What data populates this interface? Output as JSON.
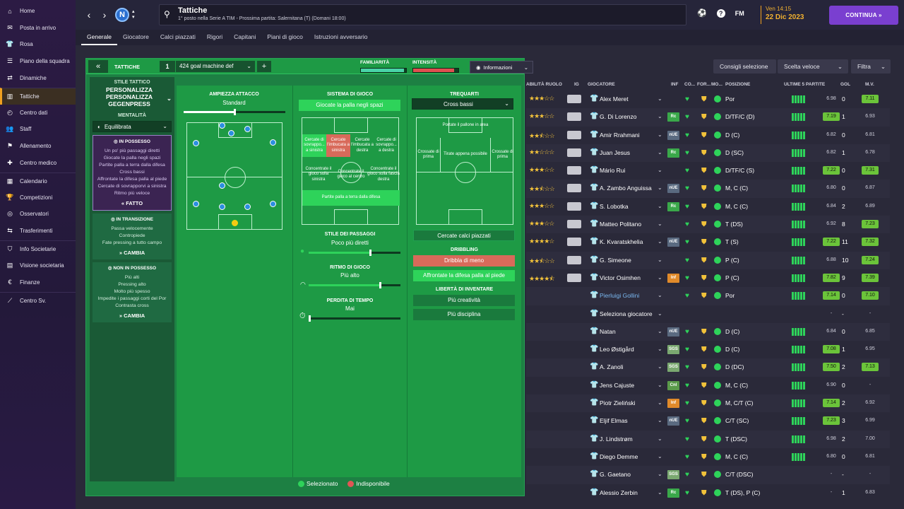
{
  "nav": [
    {
      "icon": "⌂",
      "label": "Home",
      "name": "home"
    },
    {
      "icon": "✉",
      "label": "Posta in arrivo",
      "name": "inbox"
    },
    {
      "icon": "👕",
      "label": "Rosa",
      "name": "squad"
    },
    {
      "icon": "☰",
      "label": "Piano della squadra",
      "name": "squad-plan"
    },
    {
      "icon": "⇄",
      "label": "Dinamiche",
      "name": "dynamics"
    },
    {
      "icon": "▥",
      "label": "Tattiche",
      "name": "tactics"
    },
    {
      "icon": "◴",
      "label": "Centro dati",
      "name": "data-hub"
    },
    {
      "icon": "👥",
      "label": "Staff",
      "name": "staff"
    },
    {
      "icon": "⚑",
      "label": "Allenamento",
      "name": "training"
    },
    {
      "icon": "✚",
      "label": "Centro medico",
      "name": "medical"
    },
    {
      "icon": "▦",
      "label": "Calendario",
      "name": "calendar"
    },
    {
      "icon": "🏆",
      "label": "Competizioni",
      "name": "competitions"
    },
    {
      "icon": "◎",
      "label": "Osservatori",
      "name": "scouting"
    },
    {
      "icon": "⇆",
      "label": "Trasferimenti",
      "name": "transfers"
    },
    {
      "icon": "⛉",
      "label": "Info Societarie",
      "name": "club-info"
    },
    {
      "icon": "▤",
      "label": "Visione societaria",
      "name": "club-vision"
    },
    {
      "icon": "€",
      "label": "Finanze",
      "name": "finances"
    },
    {
      "icon": "⟋",
      "label": "Centro Sv.",
      "name": "dev-centre"
    }
  ],
  "header": {
    "title": "Tattiche",
    "subtitle": "1° posto nella Serie A TIM - Prossima partita: Salernitana (T) (Domani 18:00)",
    "club_initial": "N",
    "time": "Ven 14:15",
    "date": "22 Dic 2023",
    "fm": "FM",
    "continue": "CONTINUA »"
  },
  "tabs": [
    "Generale",
    "Giocatore",
    "Calci piazzati",
    "Rigori",
    "Capitani",
    "Piani di gioco",
    "Istruzioni avversario"
  ],
  "tactic": {
    "label": "TATTICHE",
    "num": "1",
    "name": "424 goal machine def",
    "fam_label": "FAMILIARITÀ",
    "int_label": "INTENSITÀ",
    "familiarity": 0.95,
    "intensity": 0.9
  },
  "left": {
    "style_title": "STILE TATTICO",
    "style_name": "PERSONALIZZA PERSONALIZZA GEGENPRESS",
    "mentality_title": "MENTALITÀ",
    "mentality": "Equilibrata",
    "possession": {
      "title": "IN POSSESSO",
      "items": [
        "Un po' più passaggi diretti",
        "Giocate la palla negli spazi",
        "Partite palla a terra dalla difesa",
        "Cross bassi",
        "Affrontate la difesa palla al piede",
        "Cercate di sovrapporvi a sinistra",
        "Ritmo più veloce"
      ],
      "action": "FATTO"
    },
    "transition": {
      "title": "IN TRANSIZIONE",
      "items": [
        "Passa velocemente",
        "Contropiede",
        "Fate pressing a tutto campo"
      ],
      "action": "CAMBIA"
    },
    "out": {
      "title": "NON IN POSSESSO",
      "items": [
        "Più alti",
        "Pressing alto",
        "Molto più spesso",
        "Impedite i passaggi corti del Por",
        "Contrasta cross"
      ],
      "action": "CAMBIA"
    }
  },
  "board": {
    "width_title": "AMPIEZZA ATTACCO",
    "width_val": "Standard",
    "system_title": "SISTEMA DI GIOCO",
    "system_btn": "Giocate la palla negli spazi",
    "zones": [
      "Cercate di sovrappo... a sinistra",
      "Cercate l'imbucata a sinistra",
      "Cercate l'imbucata a destra",
      "Cercate di sovrappo... a destra",
      "Concentrate il gioco sulla sinistra",
      "Concentrate il gioco al centro",
      "Concentrate il gioco sulla fascia destra",
      "Partite palla a terra dalla difesa"
    ],
    "pass_title": "STILE DEI PASSAGGI",
    "pass_val": "Poco più diretti",
    "tempo_title": "RITMO DI GIOCO",
    "tempo_val": "Più alto",
    "waste_title": "PERDITA DI TEMPO",
    "waste_val": "Mai",
    "final_title": "TREQUARTI",
    "final_sel": "Cross bassi",
    "final_zones": [
      "Portate il pallone in area",
      "Crossate di prima",
      "Tirate appena possibile",
      "Crossate di prima"
    ],
    "setpiece_btn": "Cercate calci piazzati",
    "dribble_title": "DRIBBLING",
    "dribble_a": "Dribbla di meno",
    "dribble_b": "Affrontate la difesa palla al piede",
    "creative_title": "LIBERTÀ DI INVENTARE",
    "creative_a": "Più creatività",
    "creative_b": "Più disciplina",
    "legend_sel": "Selezionato",
    "legend_unav": "Indisponibile"
  },
  "toolbar": {
    "info": "Informazioni",
    "advice": "Consigli selezione",
    "quick": "Scelta veloce",
    "filter": "Filtra"
  },
  "table": {
    "headers": [
      "ABILITÀ RUOLO",
      "IG",
      "GIOCATORE",
      "INF",
      "CO...",
      "FOR...",
      "MO...",
      "POSIZIONE",
      "ULTIME 5 PARTITE",
      "GOL",
      "M.V."
    ],
    "rows": [
      {
        "stars": "★★★☆☆",
        "name": "Alex Meret",
        "inf": "",
        "pos": "Por",
        "form": "6.98",
        "gol": "0",
        "mv": "7.11",
        "hl": true
      },
      {
        "stars": "★★★☆☆",
        "name": "G. Di Lorenzo",
        "inf": "Rc",
        "pos": "D/TF/C (D)",
        "form": "7.19",
        "gol": "1",
        "mv": "6.93",
        "hl": false
      },
      {
        "stars": "★★⯪☆☆",
        "name": "Amir Rrahmani",
        "inf": "nUE",
        "pos": "D (C)",
        "form": "6.82",
        "gol": "0",
        "mv": "6.81",
        "hl": false
      },
      {
        "stars": "★★☆☆☆",
        "name": "Juan Jesus",
        "inf": "Rc",
        "pos": "D (SC)",
        "form": "6.82",
        "gol": "1",
        "mv": "6.78",
        "hl": false
      },
      {
        "stars": "★★★☆☆",
        "name": "Mário Rui",
        "inf": "",
        "pos": "D/TF/C (S)",
        "form": "7.22",
        "gol": "0",
        "mv": "7.31",
        "hl": false
      },
      {
        "stars": "★★⯪☆☆",
        "name": "A. Zambo Anguissa",
        "inf": "nUE",
        "pos": "M, C (C)",
        "form": "6.80",
        "gol": "0",
        "mv": "6.87",
        "hl": false
      },
      {
        "stars": "★★★☆☆",
        "name": "S. Lobotka",
        "inf": "Rc",
        "pos": "M, C (C)",
        "form": "6.84",
        "gol": "2",
        "mv": "6.89",
        "hl": false
      },
      {
        "stars": "★★★☆☆",
        "name": "Matteo Politano",
        "inf": "",
        "pos": "T (DS)",
        "form": "6.92",
        "gol": "8",
        "mv": "7.23",
        "hl": false
      },
      {
        "stars": "★★★★☆",
        "name": "K. Kvaratskhelia",
        "inf": "nUE",
        "pos": "T (S)",
        "form": "7.22",
        "gol": "11",
        "mv": "7.32",
        "hl": false
      },
      {
        "stars": "★★⯪☆☆",
        "name": "G. Simeone",
        "inf": "",
        "pos": "P (C)",
        "form": "6.88",
        "gol": "10",
        "mv": "7.24",
        "hl": false
      },
      {
        "stars": "★★★★⯪",
        "name": "Victor Osimhen",
        "inf": "Inf",
        "pos": "P (C)",
        "form": "7.82",
        "gol": "9",
        "mv": "7.39",
        "hl": false
      },
      {
        "stars": "",
        "name": "Pierluigi Gollini",
        "inf": "",
        "pos": "Por",
        "form": "7.14",
        "gol": "0",
        "mv": "7.10",
        "hl": false
      },
      {
        "stars": "",
        "name": "Seleziona giocatore",
        "inf": "",
        "pos": "",
        "form": "-",
        "gol": "-",
        "mv": "-",
        "hl": false
      },
      {
        "stars": "",
        "name": "Natan",
        "inf": "nUE",
        "pos": "D (C)",
        "form": "6.84",
        "gol": "0",
        "mv": "6.85",
        "hl": false
      },
      {
        "stars": "",
        "name": "Leo Østigård",
        "inf": "SGS",
        "pos": "D (C)",
        "form": "7.08",
        "gol": "1",
        "mv": "6.95",
        "hl": false
      },
      {
        "stars": "",
        "name": "A. Zanoli",
        "inf": "SGS",
        "pos": "D (DC)",
        "form": "7.50",
        "gol": "2",
        "mv": "7.13",
        "hl": false
      },
      {
        "stars": "",
        "name": "Jens Cajuste",
        "inf": "Cnl",
        "pos": "M, C (C)",
        "form": "6.90",
        "gol": "0",
        "mv": "-",
        "hl": false
      },
      {
        "stars": "",
        "name": "Piotr Zieliński",
        "inf": "Inf",
        "pos": "M, C/T (C)",
        "form": "7.14",
        "gol": "2",
        "mv": "6.92",
        "hl": false
      },
      {
        "stars": "",
        "name": "Eljif Elmas",
        "inf": "nUE",
        "pos": "C/T (SC)",
        "form": "7.23",
        "gol": "3",
        "mv": "6.99",
        "hl": false
      },
      {
        "stars": "",
        "name": "J. Lindstrøm",
        "inf": "",
        "pos": "T (DSC)",
        "form": "6.98",
        "gol": "2",
        "mv": "7.00",
        "hl": false
      },
      {
        "stars": "",
        "name": "Diego Demme",
        "inf": "",
        "pos": "M, C (C)",
        "form": "6.80",
        "gol": "0",
        "mv": "6.81",
        "hl": false
      },
      {
        "stars": "",
        "name": "G. Gaetano",
        "inf": "SGS",
        "pos": "C/T (DSC)",
        "form": "-",
        "gol": "-",
        "mv": "-",
        "hl": false
      },
      {
        "stars": "",
        "name": "Alessio Zerbin",
        "inf": "Rc",
        "pos": "T (DS), P (C)",
        "form": "-",
        "gol": "1",
        "mv": "6.83",
        "hl": false
      }
    ]
  },
  "colors": {
    "accent": "#7a3fd0",
    "pitch": "#1e9a45",
    "selected": "#2ed35a",
    "unavailable": "#e05555"
  }
}
